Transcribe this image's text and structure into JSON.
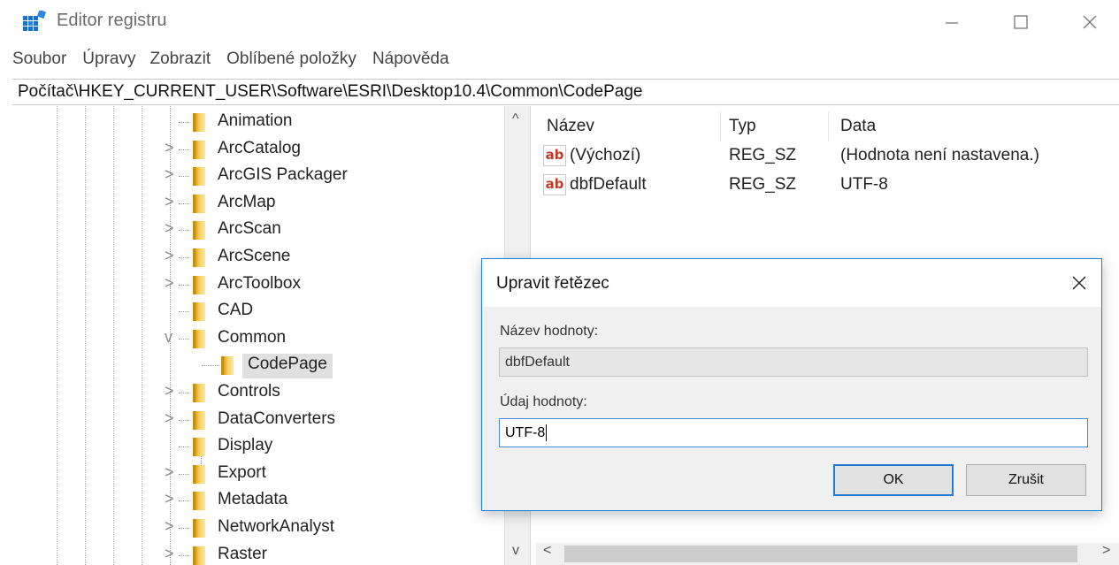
{
  "window": {
    "title": "Editor registru",
    "icon": "registry-editor-icon",
    "controls": [
      "minimize",
      "maximize",
      "close"
    ]
  },
  "menu": [
    "Soubor",
    "Úpravy",
    "Zobrazit",
    "Oblíbené položky",
    "Nápověda"
  ],
  "address": "Počítač\\HKEY_CURRENT_USER\\Software\\ESRI\\Desktop10.4\\Common\\CodePage",
  "tree": {
    "items": [
      {
        "label": "Animation",
        "expander": ""
      },
      {
        "label": "ArcCatalog",
        "expander": ">"
      },
      {
        "label": "ArcGIS Packager",
        "expander": ">"
      },
      {
        "label": "ArcMap",
        "expander": ">"
      },
      {
        "label": "ArcScan",
        "expander": ">"
      },
      {
        "label": "ArcScene",
        "expander": ">"
      },
      {
        "label": "ArcToolbox",
        "expander": ">"
      },
      {
        "label": "CAD",
        "expander": ""
      },
      {
        "label": "Common",
        "expander": "v"
      },
      {
        "label": "CodePage",
        "expander": "",
        "child": true,
        "selected": true
      },
      {
        "label": "Controls",
        "expander": ">"
      },
      {
        "label": "DataConverters",
        "expander": ">"
      },
      {
        "label": "Display",
        "expander": ""
      },
      {
        "label": "Export",
        "expander": ">"
      },
      {
        "label": "Metadata",
        "expander": ">"
      },
      {
        "label": "NetworkAnalyst",
        "expander": ">"
      },
      {
        "label": "Raster",
        "expander": ">"
      }
    ],
    "scroll_up": "^",
    "scroll_down": "v"
  },
  "values": {
    "headers": {
      "name": "Název",
      "type": "Typ",
      "data": "Data"
    },
    "rows": [
      {
        "icon": "ab",
        "name": "(Výchozí)",
        "type": "REG_SZ",
        "data": "(Hodnota není nastavena.)"
      },
      {
        "icon": "ab",
        "name": "dbfDefault",
        "type": "REG_SZ",
        "data": "UTF-8"
      }
    ],
    "scroll_left": "<",
    "scroll_right": ">"
  },
  "dialog": {
    "title": "Upravit řetězec",
    "name_label": "Název hodnoty:",
    "name_value": "dbfDefault",
    "data_label": "Údaj hodnoty:",
    "data_value": "UTF-8",
    "ok_label": "OK",
    "cancel_label": "Zrušit"
  },
  "colors": {
    "accent": "#1883d7",
    "folder": "#f6d36b",
    "selection": "#e0e0e0"
  }
}
